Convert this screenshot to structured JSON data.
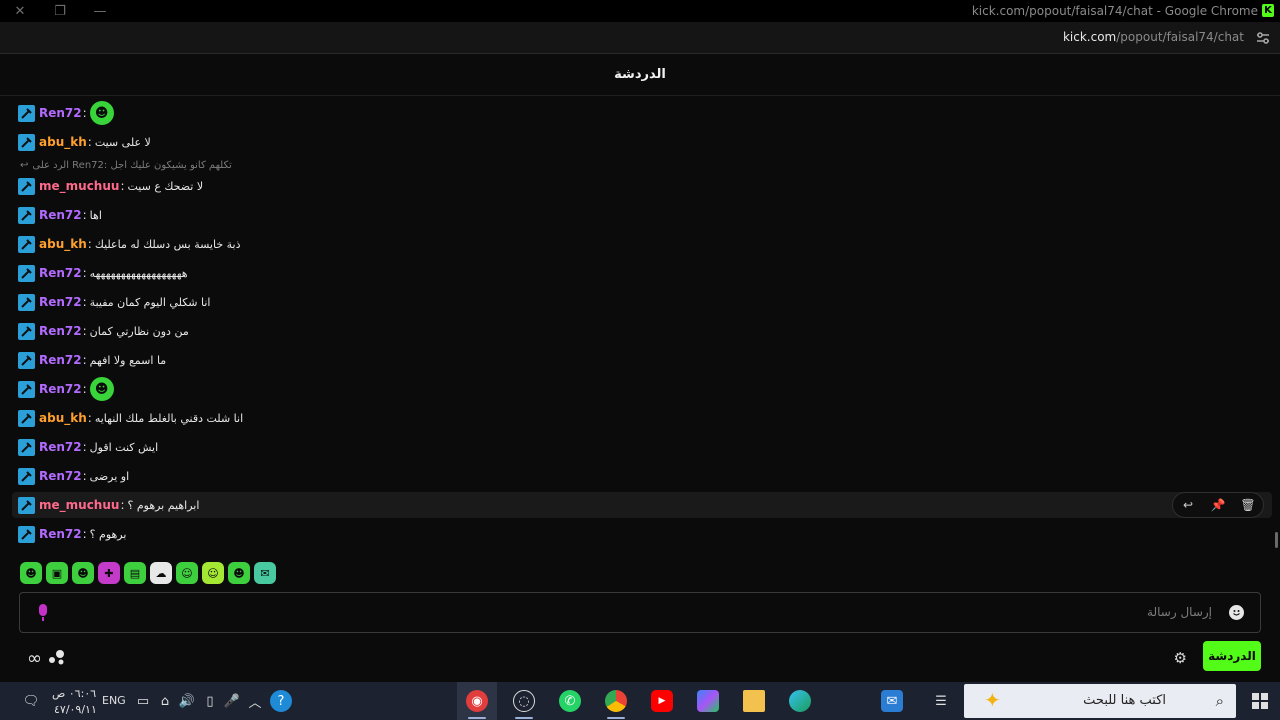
{
  "window": {
    "title": "kick.com/popout/faisal74/chat - Google Chrome",
    "favicon": "K"
  },
  "address": {
    "host": "kick.com",
    "path": "/popout/faisal74/chat"
  },
  "chat": {
    "title": "الدردشة",
    "reply_context": "الرد على Ren72: تكلهم كانو يشيكون عليك اجل",
    "messages": [
      {
        "user": "Ren72",
        "color": "#b36bff",
        "text": "",
        "emote": true
      },
      {
        "user": "abu_kh",
        "color": "#ff9f2e",
        "text": "لا على سيت"
      },
      {
        "user": "me_muchuu",
        "color": "#ff6a8c",
        "text": "لا تضحك ع سيت"
      },
      {
        "user": "Ren72",
        "color": "#b36bff",
        "text": "اها"
      },
      {
        "user": "abu_kh",
        "color": "#ff9f2e",
        "text": "ذبة خايسة بس دسلك له ماعليك"
      },
      {
        "user": "Ren72",
        "color": "#b36bff",
        "text": "ههههههههههههههههههه"
      },
      {
        "user": "Ren72",
        "color": "#b36bff",
        "text": "انا شكلي اليوم كمان مفيبة"
      },
      {
        "user": "Ren72",
        "color": "#b36bff",
        "text": "من دون نظارتي كمان"
      },
      {
        "user": "Ren72",
        "color": "#b36bff",
        "text": "ما اسمع ولا افهم"
      },
      {
        "user": "Ren72",
        "color": "#b36bff",
        "text": "",
        "emote": true
      },
      {
        "user": "abu_kh",
        "color": "#ff9f2e",
        "text": "انا شلت دقني بالغلط ملك النهايه"
      },
      {
        "user": "Ren72",
        "color": "#b36bff",
        "text": "ايش كنت اقول"
      },
      {
        "user": "Ren72",
        "color": "#b36bff",
        "text": "او يرضى"
      },
      {
        "user": "me_muchuu",
        "color": "#ff6a8c",
        "text": "ابراهيم برهوم ؟"
      },
      {
        "user": "Ren72",
        "color": "#b36bff",
        "text": "برهوم ؟"
      }
    ],
    "input_placeholder": "إرسال رسالة",
    "send_button": "الدردشة"
  },
  "taskbar": {
    "time": "٠٦:٠٦ ص",
    "date": "٤٧/٠٩/١١",
    "lang": "ENG",
    "search_placeholder": "اكتب هنا للبحث"
  },
  "colors": {
    "kick_green": "#53fc18",
    "badge_blue": "#2a9fd8"
  }
}
